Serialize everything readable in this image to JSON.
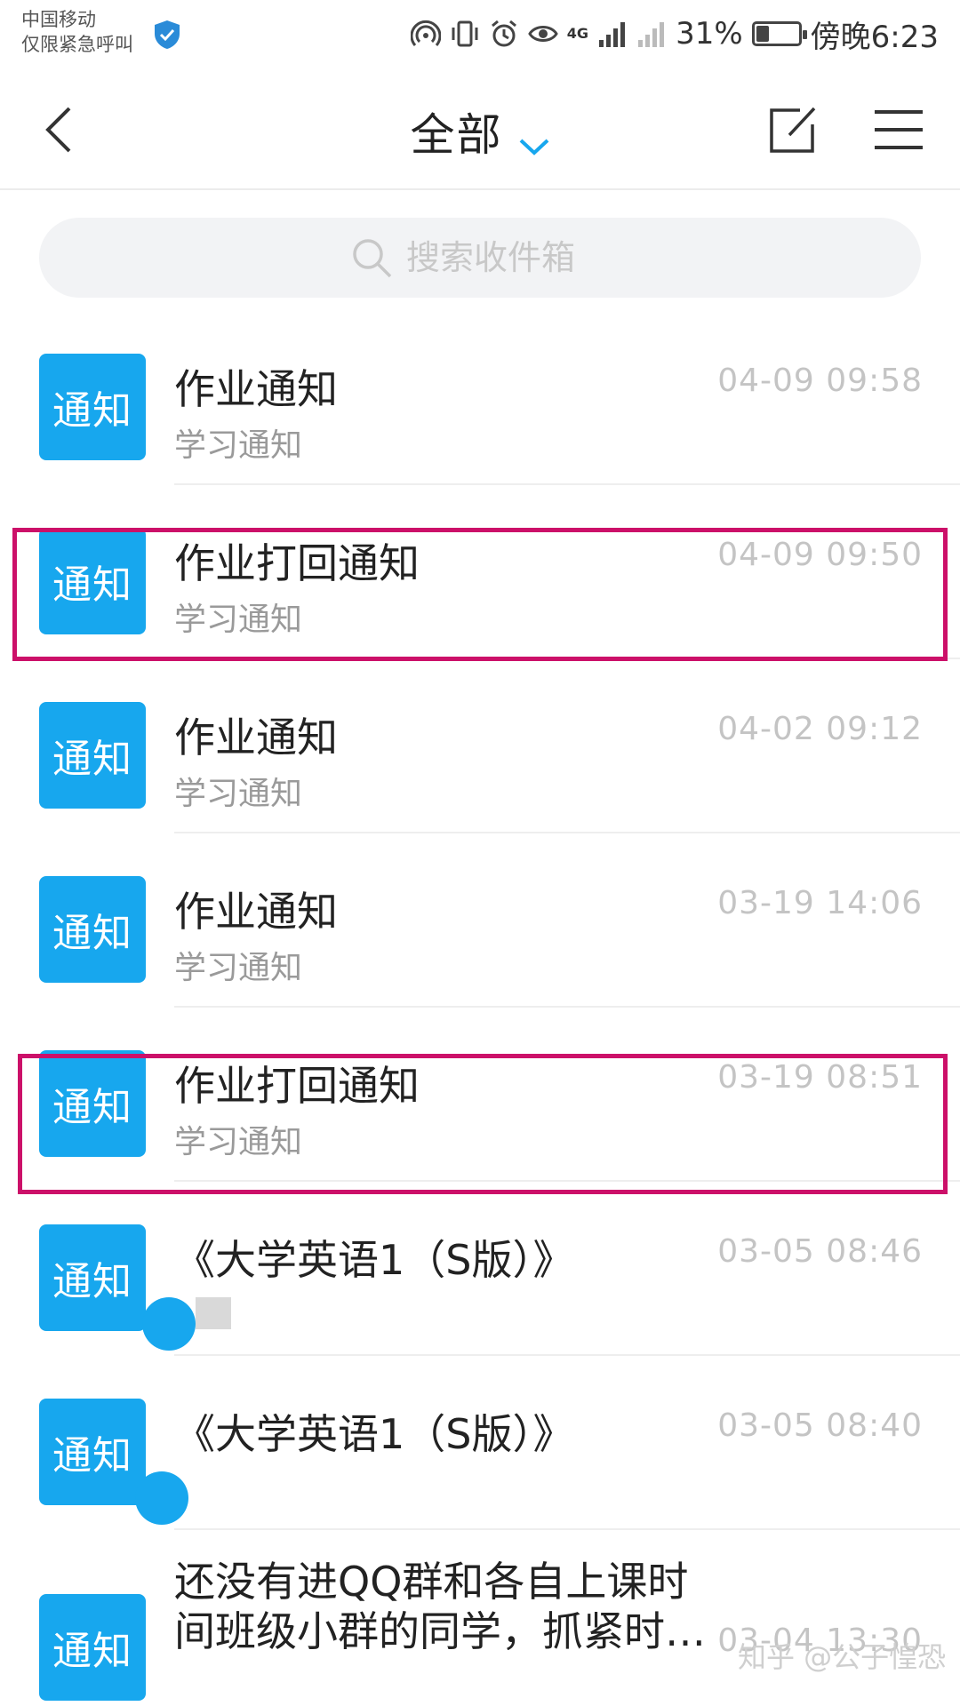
{
  "status_bar": {
    "carrier": "中国移动",
    "emergency": "仅限紧急呼叫",
    "network": "4G",
    "battery_percent": "31%",
    "battery_level": 0.31,
    "time": "傍晚6:23"
  },
  "header": {
    "title": "全部",
    "icons": [
      "back-icon",
      "chevron-down-icon",
      "compose-icon",
      "menu-icon"
    ]
  },
  "search": {
    "placeholder": "搜索收件箱"
  },
  "messages": [
    {
      "badge": "通知",
      "title": "作业通知",
      "subtitle": "学习通知",
      "time": "04-09 09:58"
    },
    {
      "badge": "通知",
      "title": "作业打回通知",
      "subtitle": "学习通知",
      "time": "04-09 09:50"
    },
    {
      "badge": "通知",
      "title": "作业通知",
      "subtitle": "学习通知",
      "time": "04-02 09:12"
    },
    {
      "badge": "通知",
      "title": "作业通知",
      "subtitle": "学习通知",
      "time": "03-19 14:06"
    },
    {
      "badge": "通知",
      "title": "作业打回通知",
      "subtitle": "学习通知",
      "time": "03-19 08:51"
    },
    {
      "badge": "通知",
      "title": "《大学英语1（S版）》",
      "subtitle": "",
      "time": "03-05 08:46"
    },
    {
      "badge": "通知",
      "title": "《大学英语1（S版）》",
      "subtitle": "",
      "time": "03-05 08:40"
    },
    {
      "badge": "通知",
      "title": "还没有进QQ群和各自上课时间班级小群的同学，抓紧时…",
      "subtitle": "",
      "time": "03-04 13:30"
    }
  ],
  "watermark": "知乎 @公子惶恐",
  "colors": {
    "accent": "#17a7ee",
    "highlight": "#cc1069",
    "time_text": "#c4c4c4"
  }
}
